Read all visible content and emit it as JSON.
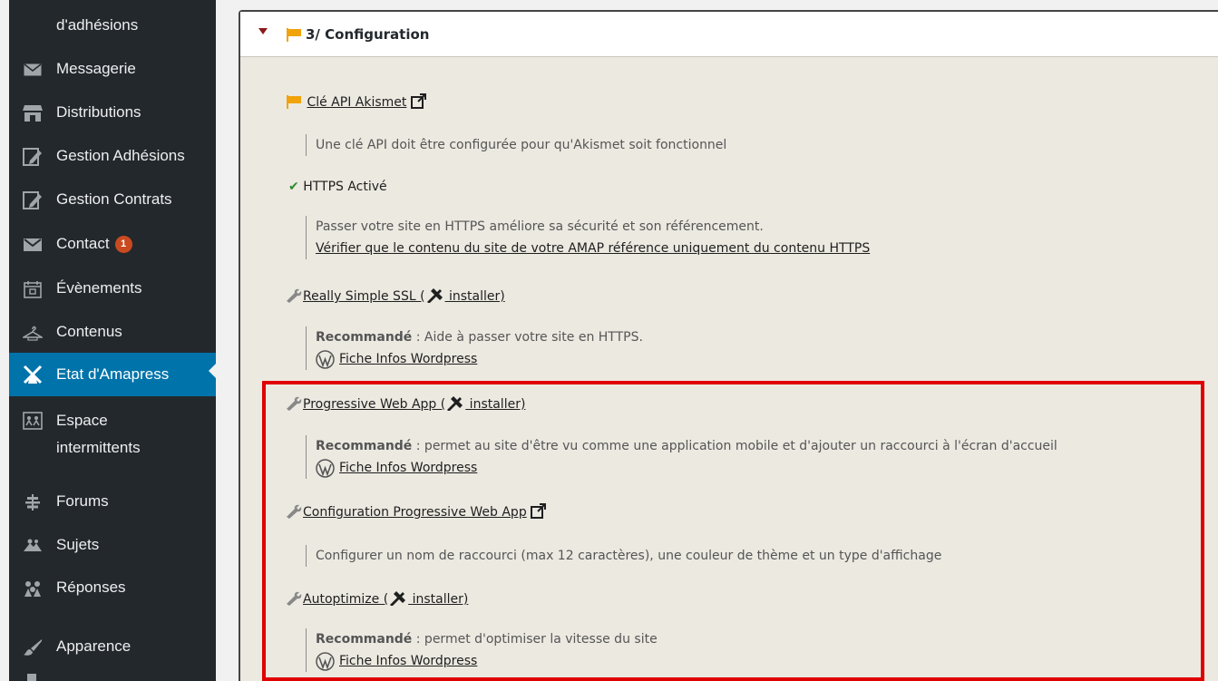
{
  "sidebar": {
    "items": [
      {
        "label": "d'adhésions",
        "icon": "none"
      },
      {
        "label": "Messagerie",
        "icon": "envelope-icon"
      },
      {
        "label": "Distributions",
        "icon": "store-icon"
      },
      {
        "label": "Gestion Adhésions",
        "icon": "edit-icon"
      },
      {
        "label": "Gestion Contrats",
        "icon": "edit-icon"
      },
      {
        "label": "Contact",
        "icon": "mail-icon",
        "badge": "1"
      },
      {
        "label": "Évènements",
        "icon": "calendar-icon"
      },
      {
        "label": "Contenus",
        "icon": "hanger-icon"
      },
      {
        "label": "Etat d'Amapress",
        "icon": "windmill-icon",
        "active": true
      },
      {
        "label": "Espace",
        "label2": "intermittents",
        "icon": "people-icon"
      },
      {
        "label": "Forums",
        "icon": "forum-icon"
      },
      {
        "label": "Sujets",
        "icon": "topics-icon"
      },
      {
        "label": "Réponses",
        "icon": "replies-icon"
      },
      {
        "label": "Apparence",
        "icon": "brush-icon"
      }
    ]
  },
  "panel": {
    "title": "3/ Configuration",
    "akismet": {
      "link": "Clé API Akismet",
      "desc": "Une clé API doit être configurée pour qu'Akismet soit fonctionnel"
    },
    "https": {
      "status": "HTTPS Activé",
      "desc": "Passer votre site en HTTPS améliore sa sécurité et son référencement.",
      "link": "Vérifier que le contenu du site de votre AMAP référence uniquement du contenu HTTPS"
    },
    "ssl": {
      "name": "Really Simple SSL (",
      "install": " installer)",
      "rec_label": "Recommandé",
      "rec_text": " : Aide à passer votre site en HTTPS.",
      "wp_link": "Fiche Infos Wordpress"
    },
    "pwa": {
      "name": "Progressive Web App (",
      "install": " installer)",
      "rec_label": "Recommandé",
      "rec_text": " : permet au site d'être vu comme une application mobile et d'ajouter un raccourci à l'écran d'accueil",
      "wp_link": "Fiche Infos Wordpress"
    },
    "pwa_config": {
      "link": "Configuration Progressive Web App",
      "desc": "Configurer un nom de raccourci (max 12 caractères), une couleur de thème et un type d'affichage"
    },
    "autoptimize": {
      "name": "Autoptimize (",
      "install": " installer)",
      "rec_label": "Recommandé",
      "rec_text": " : permet d'optimiser la vitesse du site",
      "wp_link": "Fiche Infos Wordpress"
    }
  },
  "colors": {
    "sidebar_bg": "#23282d",
    "active_bg": "#0073aa",
    "flag": "#f0a30a",
    "check": "#2e8b2e",
    "highlight": "#e00000"
  }
}
